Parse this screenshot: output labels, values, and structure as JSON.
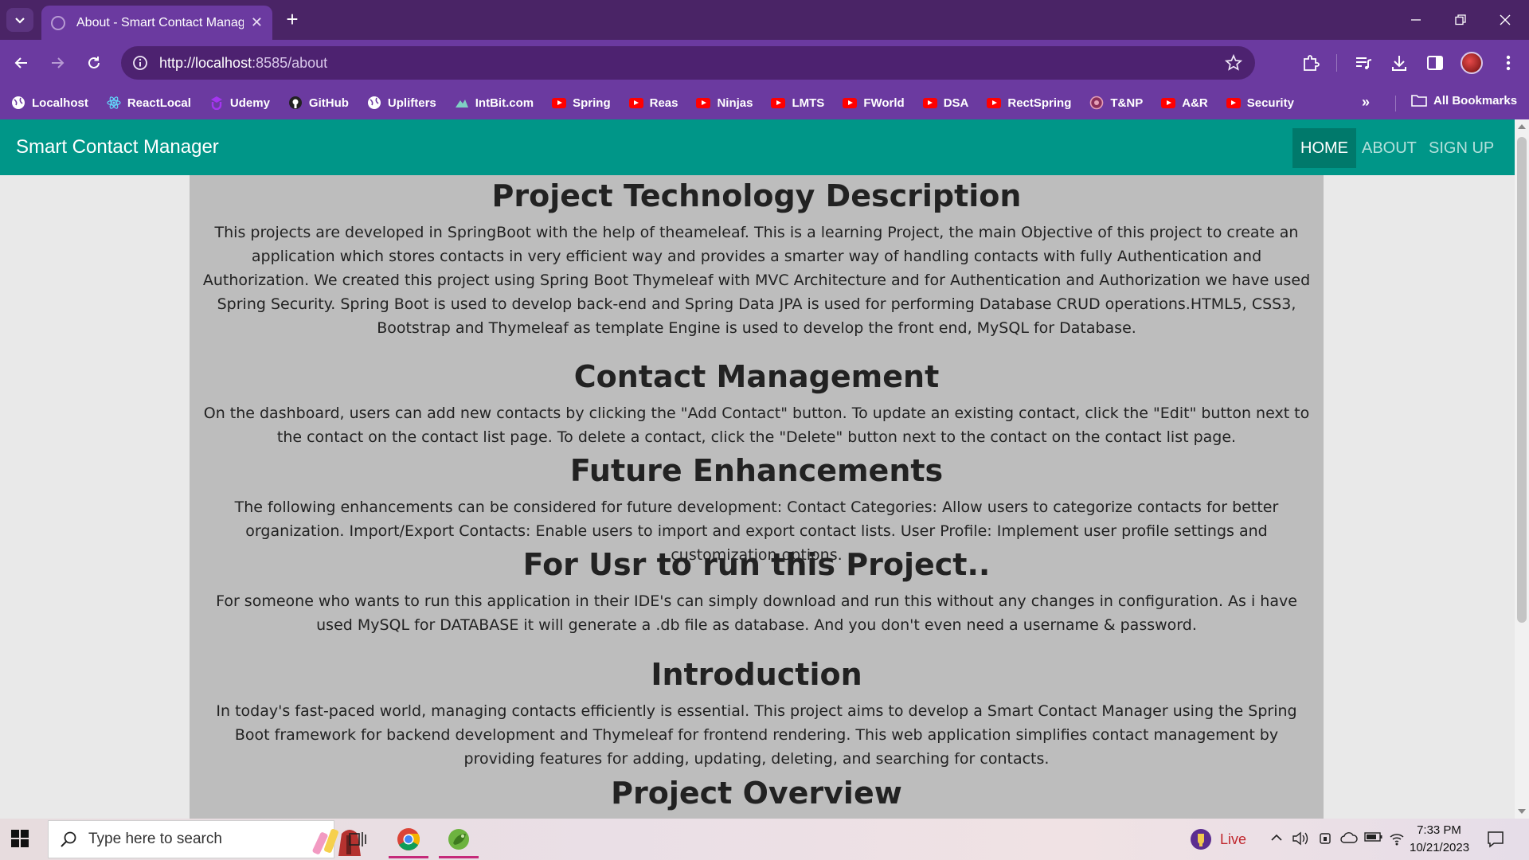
{
  "browser": {
    "tab": {
      "title": "About - Smart Contact Manag",
      "close": "✕"
    },
    "new_tab": "+",
    "address": {
      "host": "http://localhost",
      "path": ":8585/about"
    },
    "bookmarks": [
      {
        "label": "Localhost",
        "icon": "globe-icon"
      },
      {
        "label": "ReactLocal",
        "icon": "react-icon"
      },
      {
        "label": "Udemy",
        "icon": "udemy-icon"
      },
      {
        "label": "GitHub",
        "icon": "github-icon"
      },
      {
        "label": "Uplifters",
        "icon": "globe-icon"
      },
      {
        "label": "IntBit.com",
        "icon": "mountain-icon"
      },
      {
        "label": "Spring",
        "icon": "youtube-icon"
      },
      {
        "label": "Reas",
        "icon": "youtube-icon"
      },
      {
        "label": "Ninjas",
        "icon": "youtube-icon"
      },
      {
        "label": "LMTS",
        "icon": "youtube-icon"
      },
      {
        "label": "FWorld",
        "icon": "youtube-icon"
      },
      {
        "label": "DSA",
        "icon": "youtube-icon"
      },
      {
        "label": "RectSpring",
        "icon": "youtube-icon"
      },
      {
        "label": "T&NP",
        "icon": "circle-logo-icon"
      },
      {
        "label": "A&R",
        "icon": "youtube-icon"
      },
      {
        "label": "Security",
        "icon": "youtube-icon"
      }
    ],
    "bookmarks_more": "»",
    "all_bookmarks": "All Bookmarks",
    "colors": {
      "frame": "#4a2466",
      "toolbar": "#6b3aa0",
      "omnibox": "#4d2270"
    }
  },
  "site": {
    "brand": "Smart Contact Manager",
    "nav": {
      "home": "HOME",
      "about": "ABOUT",
      "signup": "SIGN UP"
    },
    "colors": {
      "navbar": "#009688",
      "active": "#00796b",
      "content_bg": "#bdbdbd"
    }
  },
  "sections": [
    {
      "heading": "Project Technology Description",
      "body": "This projects are developed in SpringBoot with the help of theameleaf. This is a learning Project, the main Objective of this project to create an application which stores contacts in very efficient way and provides a smarter way of handling contacts with fully Authentication and Authorization. We created this project using Spring Boot Thymeleaf with MVC Architecture and for Authentication and Authorization we have used Spring Security. Spring Boot is used to develop back-end and Spring Data JPA is used for performing Database CRUD operations.HTML5, CSS3, Bootstrap and Thymeleaf as template Engine is used to develop the front end, MySQL for Database."
    },
    {
      "heading": "Contact Management",
      "body": "On the dashboard, users can add new contacts by clicking the \"Add Contact\" button. To update an existing contact, click the \"Edit\" button next to the contact on the contact list page. To delete a contact, click the \"Delete\" button next to the contact on the contact list page."
    },
    {
      "heading": "Future Enhancements",
      "body": "The following enhancements can be considered for future development: Contact Categories: Allow users to categorize contacts for better organization. Import/Export Contacts: Enable users to import and export contact lists. User Profile: Implement user profile settings and customization options."
    },
    {
      "heading": "For Usr to run this Project..",
      "body": "For someone who wants to run this application in their IDE's can simply download and run this without any changes in configuration. As i have used MySQL for DATABASE it will generate a .db file as database. And you don't even need a username & password."
    },
    {
      "heading": "Introduction",
      "body": "In today's fast-paced world, managing contacts efficiently is essential. This project aims to develop a Smart Contact Manager using the Spring Boot framework for backend development and Thymeleaf for frontend rendering. This web application simplifies contact management by providing features for adding, updating, deleting, and searching for contacts."
    },
    {
      "heading": "Project Overview",
      "body": ""
    }
  ],
  "taskbar": {
    "search_placeholder": "Type here to search",
    "live": "Live",
    "time": "7:33 PM",
    "date": "10/21/2023"
  }
}
